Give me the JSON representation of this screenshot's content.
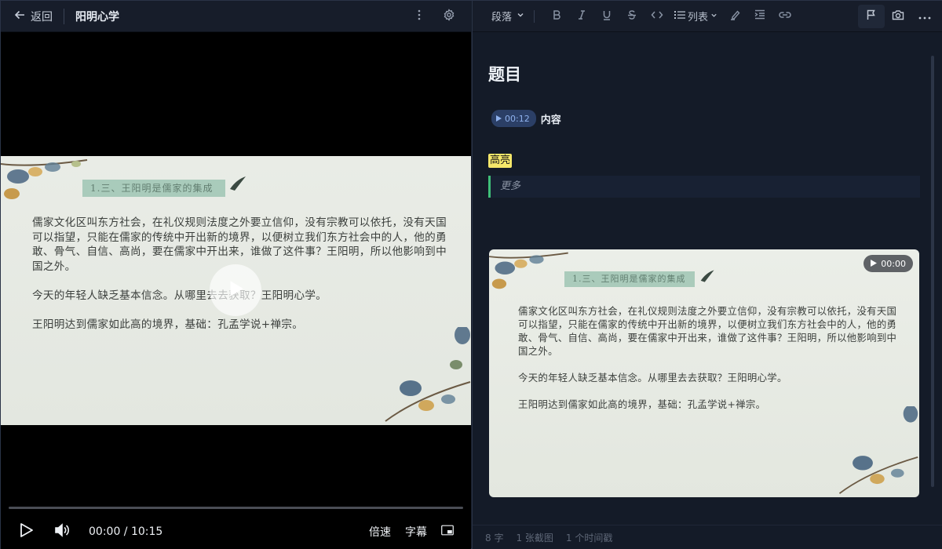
{
  "header": {
    "back_label": "返回",
    "course_title": "阳明心学"
  },
  "video": {
    "current_time": "00:00 / 10:15",
    "progress": 0,
    "speed_label": "倍速",
    "subtitle_label": "字幕",
    "slide": {
      "heading": "1.三、王阳明是儒家的集成",
      "paragraphs": [
        "儒家文化区叫东方社会，在礼仪规则法度之外要立信仰，没有宗教可以依托，没有天国可以指望，只能在儒家的传统中开出新的境界，以便树立我们东方社会中的人，他的勇敢、骨气、自信、高尚，要在儒家中开出来，谁做了这件事？王阳明，所以他影响到中国之外。",
        "今天的年轻人缺乏基本信念。从哪里去去获取？王阳明心学。",
        "王阳明达到儒家如此高的境界，基础：孔孟学说+禅宗。"
      ]
    }
  },
  "toolbar": {
    "paragraph_label": "段落",
    "list_label": "列表"
  },
  "note": {
    "title": "题目",
    "timestamp": "00:12",
    "timestamp_text": "内容",
    "highlight_text": "高亮",
    "quote_text": "更多",
    "screenshot_time": "00:00"
  },
  "status": {
    "word_count": "8 字",
    "screenshot_count": "1 张截图",
    "timestamp_count": "1 个时间戳"
  },
  "colors": {
    "accent_green": "#3fbf78",
    "highlight_yellow": "#f5e76a",
    "timestamp_chip": "#2b3f66"
  }
}
